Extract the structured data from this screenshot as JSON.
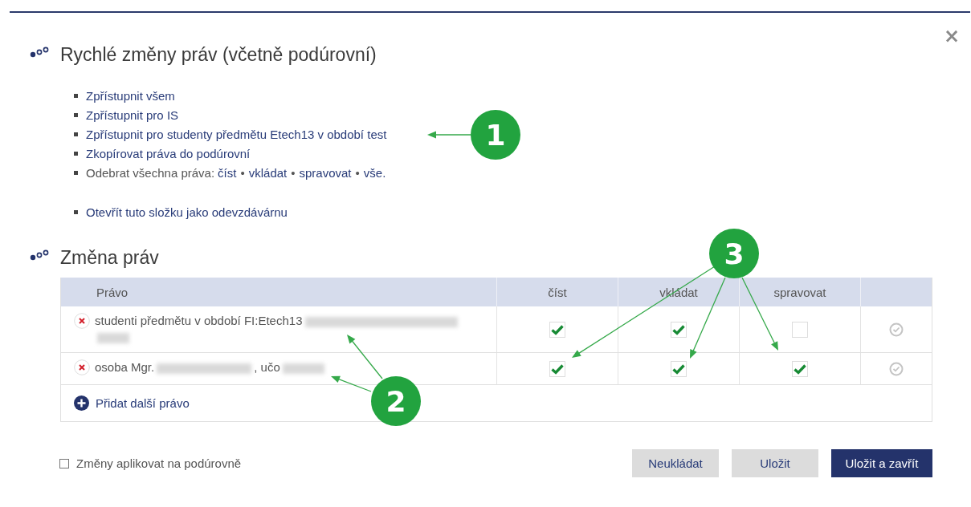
{
  "dialog": {
    "close": "×"
  },
  "quick_section": {
    "title": "Rychlé změny práv (včetně podúrovní)",
    "items": [
      {
        "kind": "link",
        "text": "Zpřístupnit všem"
      },
      {
        "kind": "link",
        "text": "Zpřístupnit pro IS"
      },
      {
        "kind": "link",
        "text": "Zpřístupnit pro studenty předmětu Etech13 v období test"
      },
      {
        "kind": "link",
        "text": "Zkopírovat práva do podúrovní"
      },
      {
        "kind": "actions",
        "text": "Odebrat všechna práva:",
        "separator": "•",
        "links": [
          "číst",
          "vkládat",
          "spravovat",
          "vše."
        ]
      }
    ],
    "folder_items": [
      {
        "kind": "link",
        "text": "Otevřít tuto složku jako odevzdávárnu"
      }
    ]
  },
  "rights_section": {
    "title": "Změna práv",
    "table": {
      "columns": [
        "Právo",
        "číst",
        "vkládat",
        "spravovat"
      ],
      "rows": [
        {
          "parts": [
            {
              "kind": "text",
              "text": "studenti předmětu v období FI:Etech13"
            },
            {
              "kind": "redacted"
            },
            {
              "kind": "redacted"
            }
          ],
          "checks": [
            {
              "checked": true
            },
            {
              "checked": true
            },
            {
              "checked": false
            }
          ]
        },
        {
          "parts": [
            {
              "kind": "text",
              "text": "osoba Mgr."
            },
            {
              "kind": "redacted"
            },
            {
              "kind": "text",
              "text": ", učo"
            },
            {
              "kind": "redacted"
            }
          ],
          "checks": [
            {
              "checked": true
            },
            {
              "checked": true
            },
            {
              "checked": true
            }
          ]
        }
      ],
      "add_row": "Přidat další právo"
    }
  },
  "footer": {
    "apply_to_sublevels": {
      "label": "Změny aplikovat na podúrovně",
      "checked": false
    },
    "buttons": [
      {
        "label": "Neukládat",
        "kind": "secondary"
      },
      {
        "label": "Uložit",
        "kind": "secondary"
      },
      {
        "label": "Uložit a zavřít",
        "kind": "primary"
      }
    ]
  },
  "callouts": [
    {
      "label": "1"
    },
    {
      "label": "2"
    },
    {
      "label": "3"
    }
  ]
}
